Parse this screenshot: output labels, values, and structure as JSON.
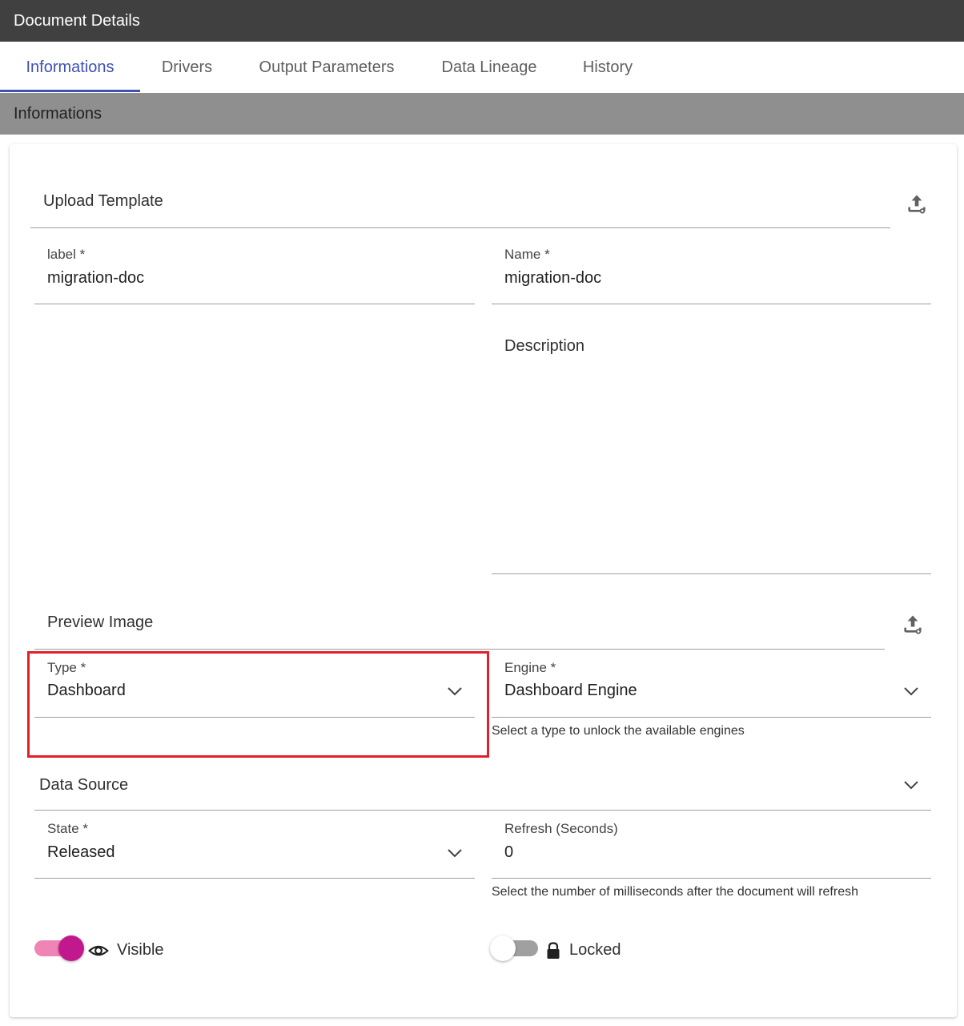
{
  "window": {
    "title": "Document Details"
  },
  "tabs": [
    {
      "label": "Informations",
      "active": true
    },
    {
      "label": "Drivers",
      "active": false
    },
    {
      "label": "Output Parameters",
      "active": false
    },
    {
      "label": "Data Lineage",
      "active": false
    },
    {
      "label": "History",
      "active": false
    }
  ],
  "section": {
    "title": "Informations"
  },
  "upload_template": {
    "label": "Upload Template",
    "icon": "upload-icon"
  },
  "fields": {
    "label": {
      "label": "label *",
      "value": "migration-doc"
    },
    "name": {
      "label": "Name *",
      "value": "migration-doc"
    },
    "description": {
      "label": "Description",
      "value": ""
    },
    "type": {
      "label": "Type *",
      "value": "Dashboard"
    },
    "engine": {
      "label": "Engine *",
      "value": "Dashboard Engine",
      "helper": "Select a type to unlock the available engines"
    },
    "state": {
      "label": "State *",
      "value": "Released"
    },
    "refresh": {
      "label": "Refresh (Seconds)",
      "value": "0",
      "helper": "Select the number of milliseconds after the document will refresh"
    }
  },
  "preview_image": {
    "label": "Preview Image",
    "icon": "upload-icon"
  },
  "data_source": {
    "label": "Data Source"
  },
  "toggles": {
    "visible": {
      "label": "Visible",
      "on": true,
      "icon": "eye-icon"
    },
    "locked": {
      "label": "Locked",
      "on": false,
      "icon": "lock-icon"
    }
  },
  "colors": {
    "accent": "#3f51b5",
    "toggle_on": "#c2188e",
    "highlight": "#e0202a"
  }
}
